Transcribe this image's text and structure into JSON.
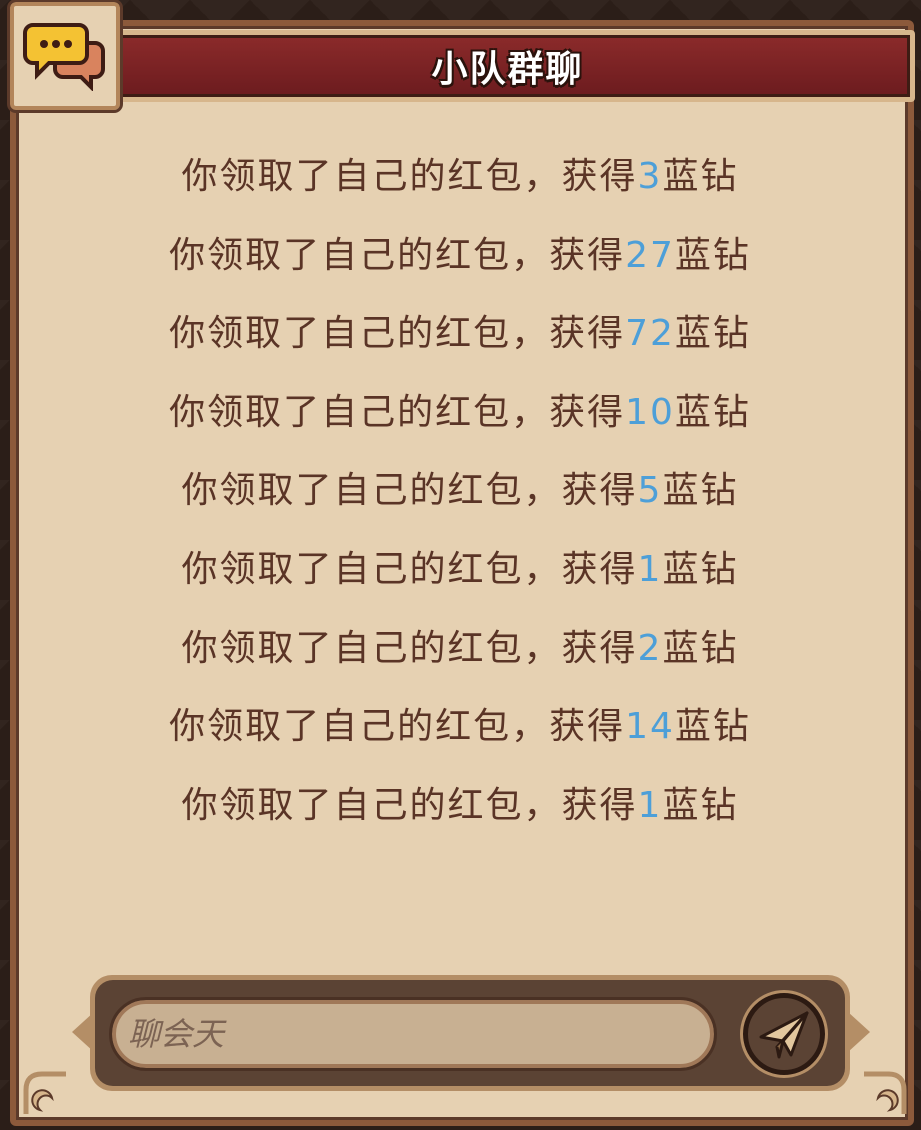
{
  "header": {
    "title": "小队群聊",
    "icon": "chat-bubbles-icon"
  },
  "messages": [
    {
      "prefix": "你领取了自己的红包，获得",
      "amount": "3",
      "suffix": "蓝钻"
    },
    {
      "prefix": "你领取了自己的红包，获得",
      "amount": "27",
      "suffix": "蓝钻"
    },
    {
      "prefix": "你领取了自己的红包，获得",
      "amount": "72",
      "suffix": "蓝钻"
    },
    {
      "prefix": "你领取了自己的红包，获得",
      "amount": "10",
      "suffix": "蓝钻"
    },
    {
      "prefix": "你领取了自己的红包，获得",
      "amount": "5",
      "suffix": "蓝钻"
    },
    {
      "prefix": "你领取了自己的红包，获得",
      "amount": "1",
      "suffix": "蓝钻"
    },
    {
      "prefix": "你领取了自己的红包，获得",
      "amount": "2",
      "suffix": "蓝钻"
    },
    {
      "prefix": "你领取了自己的红包，获得",
      "amount": "14",
      "suffix": "蓝钻"
    },
    {
      "prefix": "你领取了自己的红包，获得",
      "amount": "1",
      "suffix": "蓝钻"
    }
  ],
  "input": {
    "placeholder": "聊会天",
    "value": ""
  },
  "send": {
    "icon": "paper-plane-icon"
  },
  "colors": {
    "text": "#5a3426",
    "amount": "#4d9fd8",
    "banner": "#7a2224",
    "parchment": "#e6d1b2"
  }
}
